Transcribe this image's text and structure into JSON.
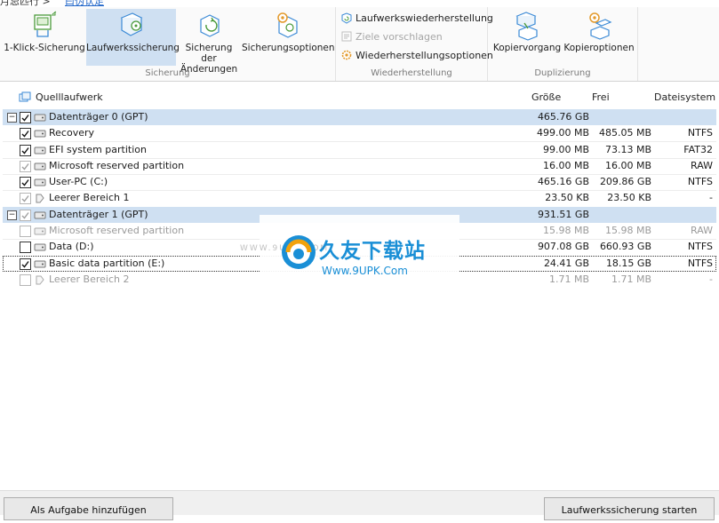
{
  "top_strip": {
    "left_text": "月忌匹行 >",
    "link_text": "曰伪认足"
  },
  "ribbon": {
    "groups": [
      {
        "label": "Sicherung",
        "buttons": [
          "1-Klick-Sicherung",
          "Laufwerkssicherung",
          "Sicherung der Änderungen",
          "Sicherungsoptionen"
        ]
      },
      {
        "label": "Wiederherstellung",
        "buttons": [
          "Laufwerkswiederherstellung",
          "Ziele vorschlagen",
          "Wiederherstellungsoptionen"
        ]
      },
      {
        "label": "Duplizierung",
        "buttons": [
          "Kopiervorgang",
          "Kopieroptionen"
        ]
      }
    ],
    "active_button": "Laufwerkssicherung"
  },
  "table": {
    "headers": {
      "name": "Quelllaufwerk",
      "size": "Größe",
      "free": "Frei",
      "fs": "Dateisystem"
    },
    "rows": [
      {
        "name": "Datenträger 0 (GPT)",
        "size": "465.76 GB",
        "free": "",
        "fs": ""
      },
      {
        "name": "Recovery",
        "size": "499.00 MB",
        "free": "485.05 MB",
        "fs": "NTFS"
      },
      {
        "name": "EFI system partition",
        "size": "99.00 MB",
        "free": "73.13 MB",
        "fs": "FAT32"
      },
      {
        "name": "Microsoft reserved partition",
        "size": "16.00 MB",
        "free": "16.00 MB",
        "fs": "RAW"
      },
      {
        "name": "User-PC (C:)",
        "size": "465.16 GB",
        "free": "209.86 GB",
        "fs": "NTFS"
      },
      {
        "name": "Leerer Bereich 1",
        "size": "23.50 KB",
        "free": "23.50 KB",
        "fs": "-"
      },
      {
        "name": "Datenträger 1 (GPT)",
        "size": "931.51 GB",
        "free": "",
        "fs": ""
      },
      {
        "name": "Microsoft reserved partition",
        "size": "15.98 MB",
        "free": "15.98 MB",
        "fs": "RAW"
      },
      {
        "name": "Data (D:)",
        "size": "907.08 GB",
        "free": "660.93 GB",
        "fs": "NTFS"
      },
      {
        "name": "Basic data partition (E:)",
        "size": "24.41 GB",
        "free": "18.15 GB",
        "fs": "NTFS"
      },
      {
        "name": "Leerer Bereich 2",
        "size": "1.71 MB",
        "free": "1.71 MB",
        "fs": "-"
      }
    ]
  },
  "watermark": {
    "title": "久友下载站",
    "url": "Www.9UPK.Com",
    "faint": "WWW.9UPK.COM"
  },
  "bottom": {
    "add_task": "Als Aufgabe hinzufügen",
    "start": "Laufwerkssicherung starten"
  },
  "colors": {
    "selection": "#cfe0f2",
    "accent": "#1a8fd6",
    "link": "#1e64c8"
  }
}
